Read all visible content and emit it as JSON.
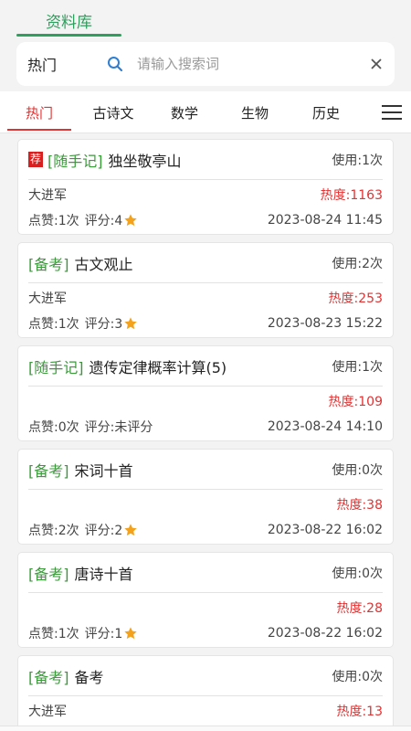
{
  "header": {
    "tab_label": "资料库"
  },
  "search": {
    "scope": "热门",
    "placeholder": "请输入搜索词",
    "value": ""
  },
  "tabs": [
    "热门",
    "古诗文",
    "数学",
    "生物",
    "历史"
  ],
  "items": [
    {
      "badge": "荐",
      "category": "[随手记]",
      "title": "独坐敬亭山",
      "usage": "使用:1次",
      "author": "大进军",
      "heat": "热度:1163",
      "likes": "点赞:1次",
      "rating": "评分:4",
      "star": true,
      "date": "2023-08-24 11:45"
    },
    {
      "badge": "",
      "category": "[备考]",
      "title": "古文观止",
      "usage": "使用:2次",
      "author": "大进军",
      "heat": "热度:253",
      "likes": "点赞:1次",
      "rating": "评分:3",
      "star": true,
      "date": "2023-08-23 15:22"
    },
    {
      "badge": "",
      "category": "[随手记]",
      "title": "遗传定律概率计算(5)",
      "usage": "使用:1次",
      "author": "",
      "heat": "热度:109",
      "likes": "点赞:0次",
      "rating": "评分:未评分",
      "star": false,
      "date": "2023-08-24 14:10"
    },
    {
      "badge": "",
      "category": "[备考]",
      "title": "宋词十首",
      "usage": "使用:0次",
      "author": "",
      "heat": "热度:38",
      "likes": "点赞:2次",
      "rating": "评分:2",
      "star": true,
      "date": "2023-08-22 16:02"
    },
    {
      "badge": "",
      "category": "[备考]",
      "title": "唐诗十首",
      "usage": "使用:0次",
      "author": "",
      "heat": "热度:28",
      "likes": "点赞:1次",
      "rating": "评分:1",
      "star": true,
      "date": "2023-08-22 16:02"
    },
    {
      "badge": "",
      "category": "[备考]",
      "title": "备考",
      "usage": "使用:0次",
      "author": "大进军",
      "heat": "热度:13",
      "likes": "",
      "rating": "",
      "star": false,
      "date": ""
    }
  ],
  "colors": {
    "accent": "#2e9f5d",
    "active": "#e03333",
    "category": "#3a9a3a",
    "heat": "#e03333",
    "star": "#f4a21b",
    "badge": "#d81e1e"
  }
}
